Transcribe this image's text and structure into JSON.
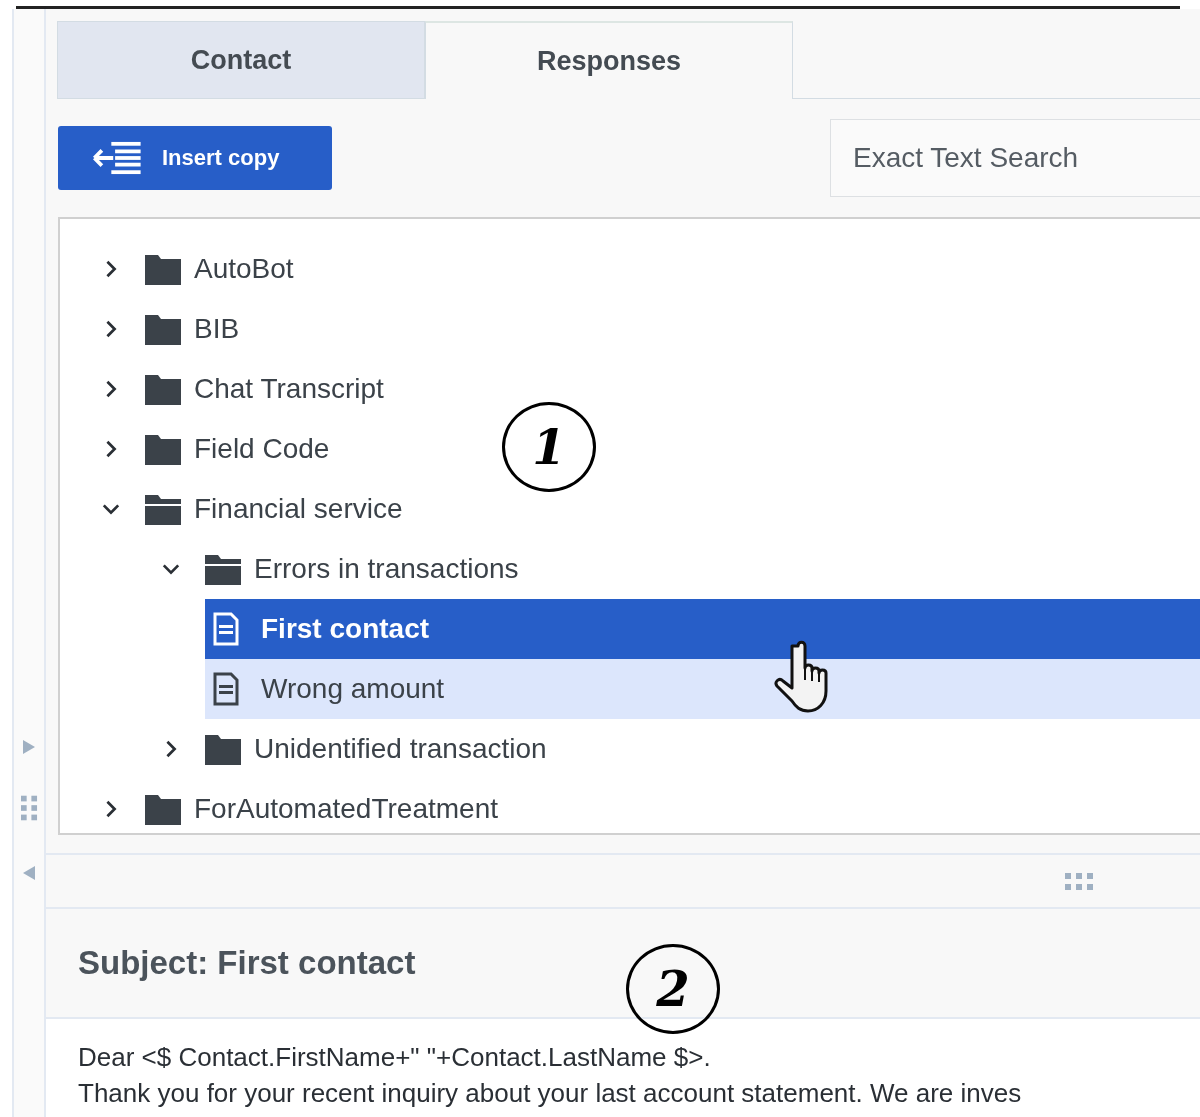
{
  "tabs": [
    {
      "label": "Contact",
      "selected": false
    },
    {
      "label": "Responses",
      "selected": true
    }
  ],
  "toolbar": {
    "insert_button": "Insert copy",
    "search": {
      "placeholder": "Exact Text Search"
    }
  },
  "tree": [
    {
      "kind": "folder",
      "label": "AutoBot",
      "expanded": false
    },
    {
      "kind": "folder",
      "label": "BIB",
      "expanded": false
    },
    {
      "kind": "folder",
      "label": "Chat Transcript",
      "expanded": false
    },
    {
      "kind": "folder",
      "label": "Field Code",
      "expanded": false
    },
    {
      "kind": "folder",
      "label": "Financial service",
      "expanded": true,
      "children": [
        {
          "kind": "folder",
          "label": "Errors in transactions",
          "expanded": true,
          "children": [
            {
              "kind": "response",
              "label": "First contact",
              "selected": true,
              "hovered": false
            },
            {
              "kind": "response",
              "label": "Wrong amount",
              "selected": false,
              "hovered": true
            }
          ]
        },
        {
          "kind": "folder",
          "label": "Unidentified transaction",
          "expanded": false
        }
      ]
    },
    {
      "kind": "folder",
      "label": "ForAutomatedTreatment",
      "expanded": false
    }
  ],
  "preview": {
    "subject": "Subject: First contact",
    "body": [
      "Dear <$ Contact.FirstName+\" \"+Contact.LastName $>.",
      "Thank you for your recent inquiry about your last account statement. We are inves"
    ]
  },
  "annotations": [
    {
      "label": "1"
    },
    {
      "label": "2"
    }
  ]
}
